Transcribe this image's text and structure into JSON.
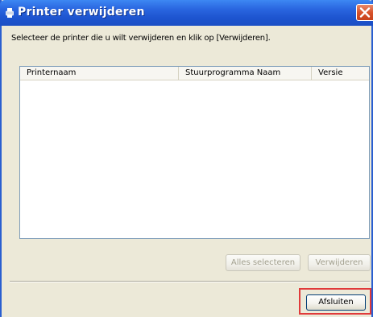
{
  "window": {
    "title": "Printer verwijderen",
    "title_icon": "printer-icon",
    "close_icon": "close-icon",
    "colors": {
      "titlebar": "#2a66e0",
      "close_button": "#d8532c",
      "highlight": "#e03a3a"
    }
  },
  "instruction": "Selecteer de printer die u wilt verwijderen en klik op [Verwijderen].",
  "list": {
    "columns": [
      "Printernaam",
      "Stuurprogramma Naam",
      "Versie"
    ],
    "rows": []
  },
  "buttons": {
    "select_all": "Alles selecteren",
    "remove": "Verwijderen",
    "close": "Afsluiten"
  }
}
